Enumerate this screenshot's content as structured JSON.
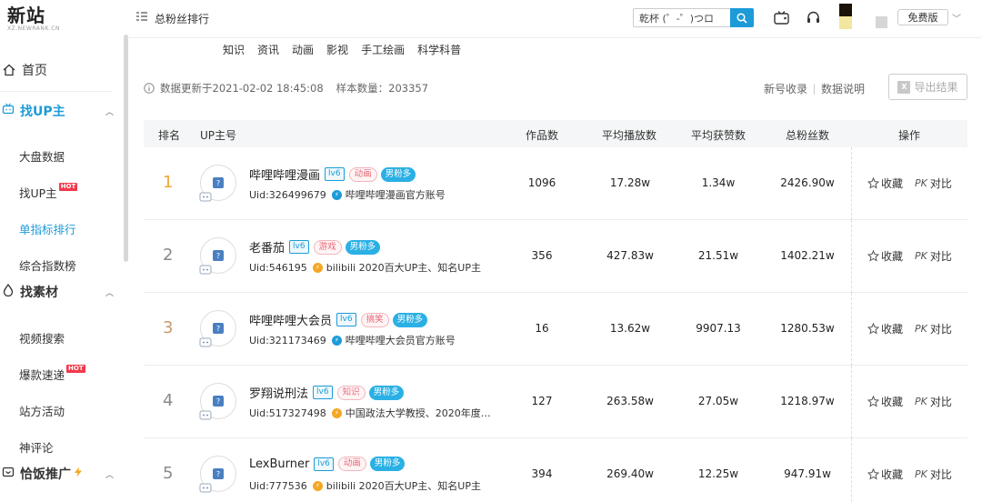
{
  "logo": {
    "main": "新站",
    "sub": "XZ.NEWRANK.CN"
  },
  "header": {
    "page_title": "总粉丝排行",
    "search_value": "乾杯 (゜-゜)つロ",
    "plan_label": "免费版"
  },
  "sidebar": {
    "home": "首页",
    "sections": [
      {
        "label": "找UP主",
        "items": [
          "大盘数据",
          "找UP主",
          "单指标排行",
          "综合指数榜"
        ]
      },
      {
        "label": "找素材",
        "items": [
          "视频搜索",
          "爆款速递",
          "站方活动",
          "神评论"
        ]
      },
      {
        "label": "恰饭推广"
      }
    ],
    "hot_label": "HOT"
  },
  "categories": [
    "知识",
    "资讯",
    "动画",
    "影视",
    "手工绘画",
    "科学科普"
  ],
  "info": {
    "updated": "数据更新于2021-02-02 18:45:08",
    "sample": "样本数量：203357",
    "link_new": "新号收录",
    "link_desc": "数据说明",
    "export": "导出结果"
  },
  "table": {
    "headers": [
      "排名",
      "UP主号",
      "作品数",
      "平均播放数",
      "平均获赞数",
      "总粉丝数",
      "操作"
    ],
    "op_fav": "收藏",
    "op_compare": "对比",
    "op_pk": "PK",
    "rows": [
      {
        "rank": "1",
        "name": "哔哩哔哩漫画",
        "lv": "lv6",
        "tag": "动画",
        "fan": "男粉多",
        "uid": "Uid:326499679",
        "verify": "哔哩哔哩漫画官方账号",
        "verify_color": "blue",
        "works": "1096",
        "avg_play": "17.28w",
        "avg_like": "1.34w",
        "fans": "2426.90w"
      },
      {
        "rank": "2",
        "name": "老番茄",
        "lv": "lv6",
        "tag": "游戏",
        "fan": "男粉多",
        "uid": "Uid:546195",
        "verify": "bilibili 2020百大UP主、知名UP主",
        "verify_color": "gold",
        "works": "356",
        "avg_play": "427.83w",
        "avg_like": "21.51w",
        "fans": "1402.21w"
      },
      {
        "rank": "3",
        "name": "哔哩哔哩大会员",
        "lv": "lv6",
        "tag": "搞笑",
        "fan": "男粉多",
        "uid": "Uid:321173469",
        "verify": "哔哩哔哩大会员官方账号",
        "verify_color": "blue",
        "works": "16",
        "avg_play": "13.62w",
        "avg_like": "9907.13",
        "fans": "1280.53w"
      },
      {
        "rank": "4",
        "name": "罗翔说刑法",
        "lv": "lv6",
        "tag": "知识",
        "fan": "男粉多",
        "uid": "Uid:517327498",
        "verify": "中国政法大学教授、2020年度…",
        "verify_color": "gold",
        "works": "127",
        "avg_play": "263.58w",
        "avg_like": "27.05w",
        "fans": "1218.97w"
      },
      {
        "rank": "5",
        "name": "LexBurner",
        "lv": "lv6",
        "tag": "动画",
        "fan": "男粉多",
        "uid": "Uid:777536",
        "verify": "bilibili 2020百大UP主、知名UP主",
        "verify_color": "gold",
        "works": "394",
        "avg_play": "269.40w",
        "avg_like": "12.25w",
        "fans": "947.91w"
      }
    ]
  }
}
